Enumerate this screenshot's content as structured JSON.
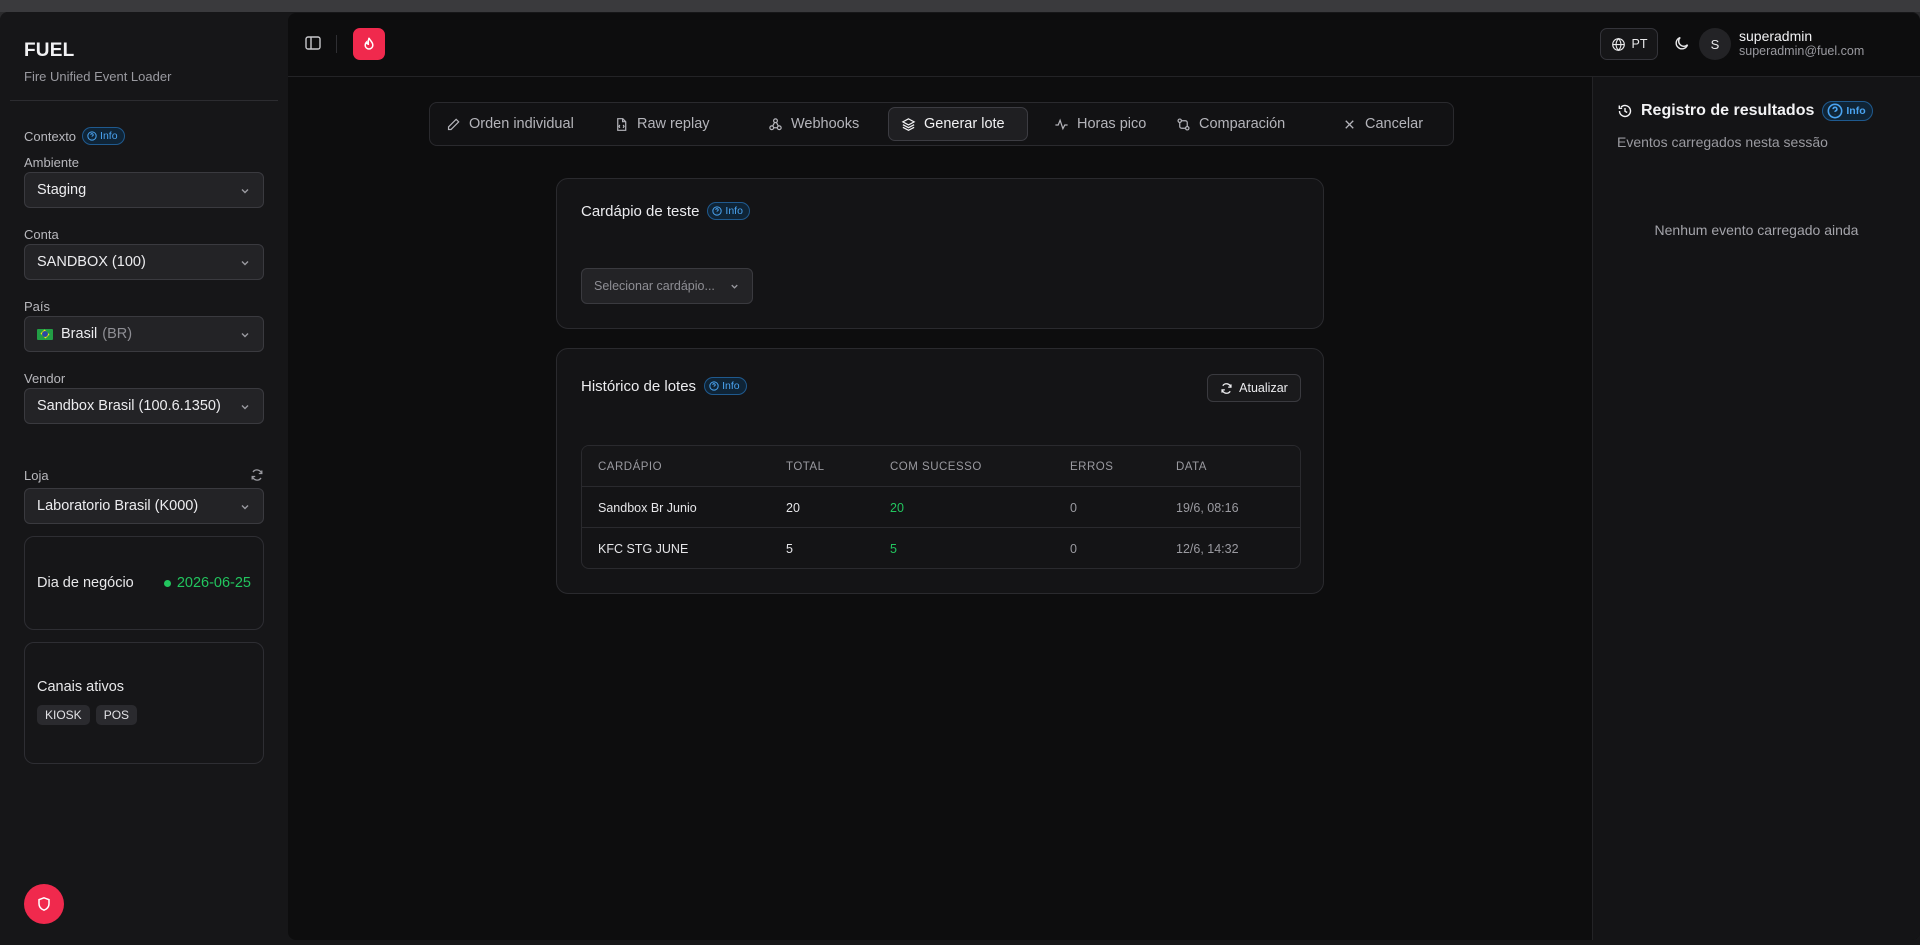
{
  "app": {
    "name": "FUEL",
    "subtitle": "Fire Unified Event Loader"
  },
  "sidebar": {
    "context_label": "Contexto",
    "info_label": "Info",
    "ambiente": {
      "label": "Ambiente",
      "value": "Staging"
    },
    "conta": {
      "label": "Conta",
      "value": "SANDBOX (100)"
    },
    "pais": {
      "label": "País",
      "value": "Brasil",
      "code": "(BR)"
    },
    "vendor": {
      "label": "Vendor",
      "value": "Sandbox Brasil (100.6.1350)"
    },
    "loja": {
      "label": "Loja",
      "value": "Laboratorio Brasil (K000)"
    },
    "business_day": {
      "label": "Dia de negócio",
      "value": "2026-06-25"
    },
    "channels": {
      "label": "Canais ativos",
      "items": [
        "KIOSK",
        "POS"
      ]
    }
  },
  "header": {
    "language": "PT",
    "user": {
      "initial": "S",
      "name": "superadmin",
      "email": "superadmin@fuel.com"
    }
  },
  "tabs": [
    {
      "label": "Orden individual",
      "icon": "pencil-icon"
    },
    {
      "label": "Raw replay",
      "icon": "file-icon"
    },
    {
      "label": "Webhooks",
      "icon": "webhook-icon"
    },
    {
      "label": "Generar lote",
      "icon": "layers-icon",
      "active": true
    },
    {
      "label": "Horas pico",
      "icon": "activity-icon"
    },
    {
      "label": "Comparación",
      "icon": "compare-icon"
    },
    {
      "label": "Cancelar",
      "icon": "close-icon"
    }
  ],
  "menu_card": {
    "title": "Cardápio de teste",
    "info_label": "Info",
    "select_placeholder": "Selecionar cardápio..."
  },
  "history_card": {
    "title": "Histórico de lotes",
    "info_label": "Info",
    "refresh_label": "Atualizar",
    "columns": [
      "CARDÁPIO",
      "TOTAL",
      "COM SUCESSO",
      "ERROS",
      "DATA"
    ],
    "rows": [
      [
        "Sandbox Br Junio",
        "20",
        "20",
        "0",
        "19/6, 08:16"
      ],
      [
        "KFC STG JUNE",
        "5",
        "5",
        "0",
        "12/6, 14:32"
      ]
    ]
  },
  "results_panel": {
    "title": "Registro de resultados",
    "info_label": "Info",
    "subtitle": "Eventos carregados nesta sessão",
    "empty": "Nenhum evento carregado ainda"
  },
  "colors": {
    "accent": "#f0294d",
    "success": "#22c55e",
    "info": "#4aa3f0"
  }
}
